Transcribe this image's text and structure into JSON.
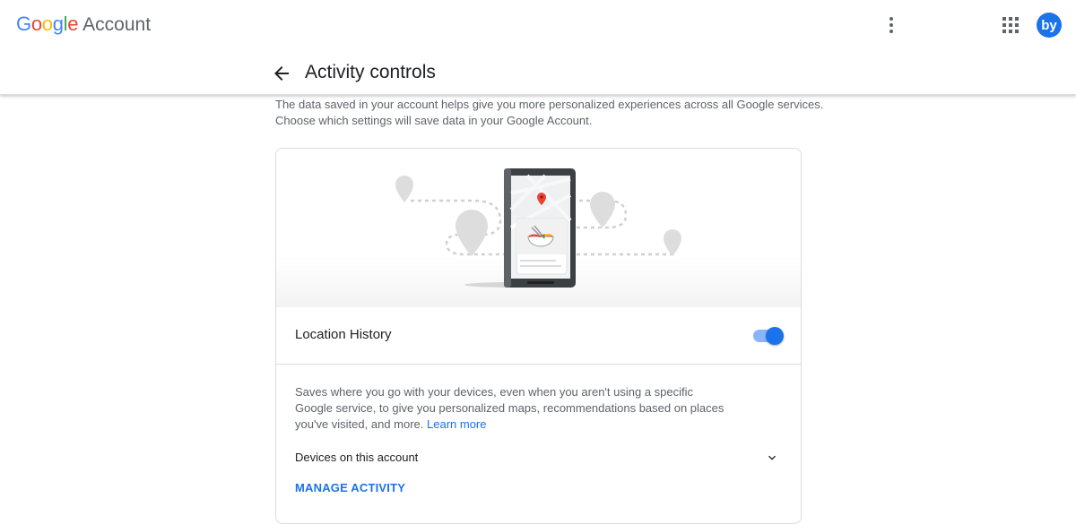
{
  "header": {
    "brand_google": "Google",
    "brand_account": "Account",
    "brand_colors": [
      "#4285F4",
      "#EA4335",
      "#FBBC05",
      "#4285F4",
      "#34A853",
      "#EA4335"
    ],
    "more_icon": "more-vert-icon",
    "apps_icon": "apps-grid-icon",
    "avatar_initials": "by",
    "avatar_color": "#1a73e8"
  },
  "page": {
    "back_icon": "arrow-back-icon",
    "title": "Activity controls",
    "intro": "The data saved in your account helps give you more personalized experiences across all Google services. Choose which settings will save data in your Google Account."
  },
  "card": {
    "illustration": "phone-map-location-illustration",
    "setting_label": "Location History",
    "toggle_on": true,
    "accent_color": "#1a73e8",
    "description": "Saves where you go with your devices, even when you aren't using a specific Google service, to give you personalized maps, recommendations based on places you've visited, and more.",
    "learn_more": "Learn more",
    "devices_label": "Devices on this account",
    "devices_icon": "chevron-down-icon",
    "manage_activity": "MANAGE ACTIVITY"
  }
}
